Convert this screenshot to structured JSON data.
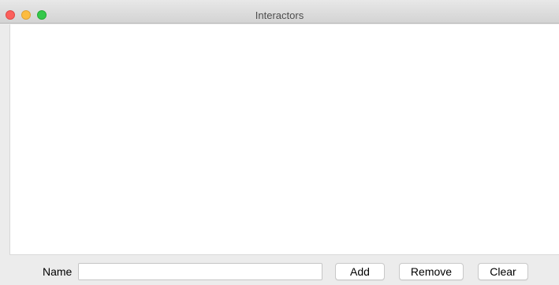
{
  "window": {
    "title": "Interactors"
  },
  "form": {
    "name_label": "Name",
    "name_value": "",
    "name_placeholder": ""
  },
  "buttons": {
    "add": "Add",
    "remove": "Remove",
    "clear": "Clear"
  },
  "colors": {
    "close": "#fc605c",
    "minimize": "#fdbc40",
    "zoom": "#34c84a",
    "window_bg": "#ececec",
    "content_bg": "#ffffff"
  }
}
